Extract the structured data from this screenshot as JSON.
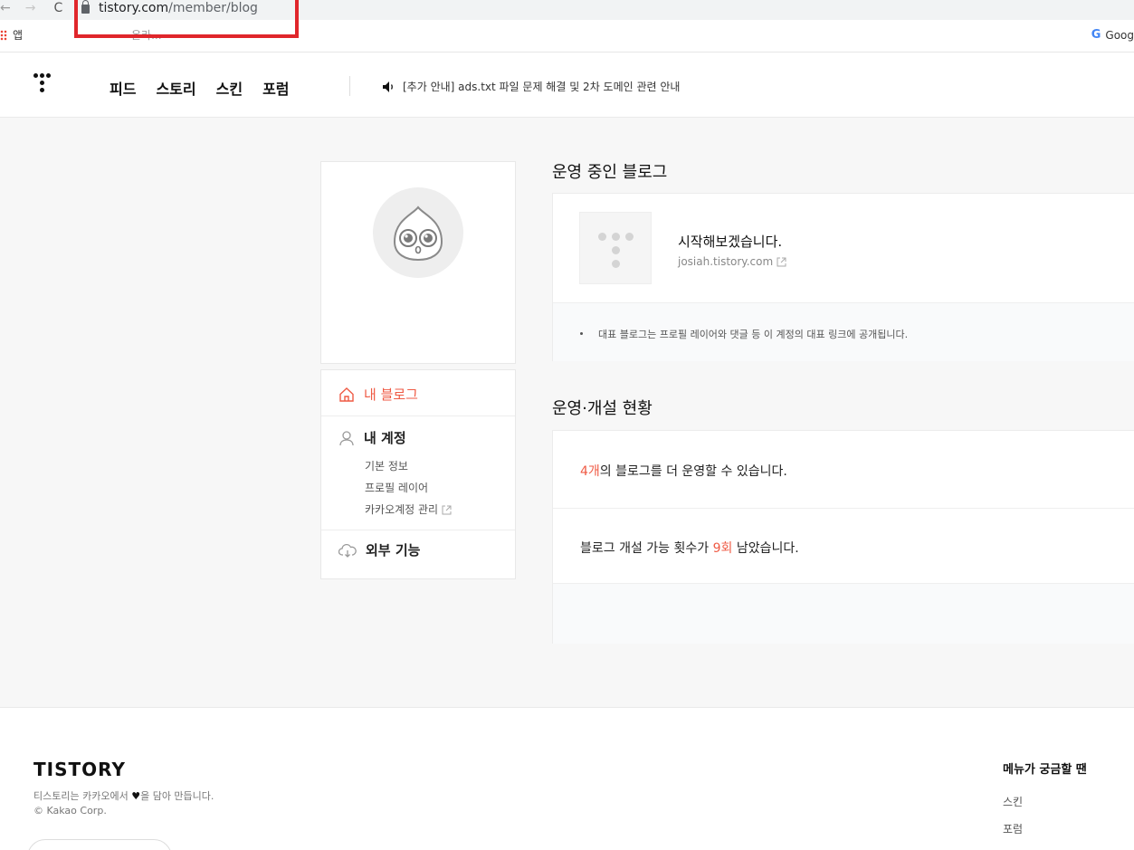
{
  "browser": {
    "url_host": "tistory.com",
    "url_path": "/member/blog",
    "bookmark_apps_label": "앱",
    "bookmark_faded": "온라...",
    "bookmark_google": "Goog"
  },
  "header": {
    "nav": [
      "피드",
      "스토리",
      "스킨",
      "포럼"
    ],
    "notice": "[추가 안내] ads.txt 파일 문제 해결 및 2차 도메인 관련 안내"
  },
  "sidebar": {
    "my_blog": "내 블로그",
    "my_account": "내 계정",
    "account_sub": [
      "기본 정보",
      "프로필 레이어",
      "카카오계정 관리"
    ],
    "external": "외부 기능"
  },
  "blogs_section": {
    "title": "운영 중인 블로그",
    "blog_name": "시작해보겠습니다.",
    "blog_url": "josiah.tistory.com",
    "note": "대표 블로그는 프로필 레이어와 댓글 등 이 계정의 대표 링크에 공개됩니다."
  },
  "status_section": {
    "title": "운영·개설 현황",
    "row1_highlight": "4개",
    "row1_rest": "의 블로그를 더 운영할 수 있습니다.",
    "row2_pre": "블로그 개설 가능 횟수가 ",
    "row2_highlight": "9회",
    "row2_post": " 남았습니다."
  },
  "footer": {
    "logo": "TISTORY",
    "line1_pre": "티스토리는 카카오에서 ",
    "line1_post": "을 담아 만듭니다.",
    "line2": "© Kakao Corp.",
    "menu_title": "메뉴가 궁금할 땐",
    "links": [
      "스킨",
      "포럼"
    ]
  },
  "colors": {
    "accent": "#ef5a44",
    "frame_highlight": "#e0262b"
  }
}
